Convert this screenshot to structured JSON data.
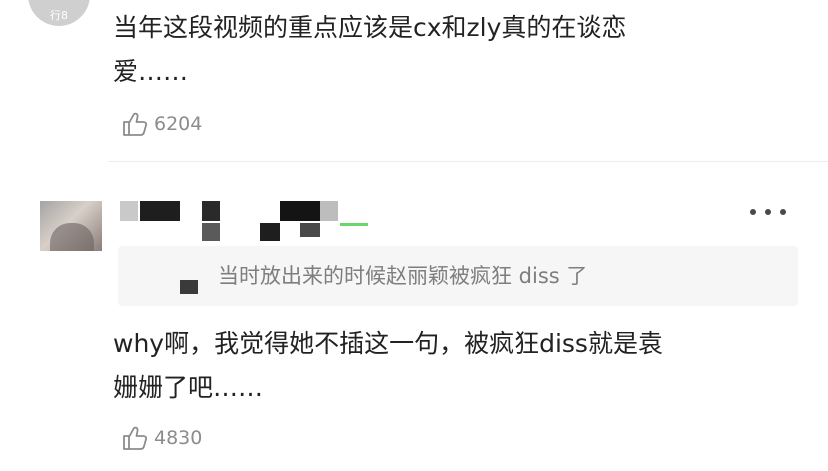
{
  "comments": [
    {
      "avatar_caption": "行8",
      "text_line1": "当年这段视频的重点应该是cx和zly真的在谈恋",
      "text_line2": "爱……",
      "likes": "6204"
    },
    {
      "quote": "当时放出来的时候赵丽颖被疯狂 diss 了",
      "text_line1": "why啊，我觉得她不插这一句，被疯狂diss就是袁",
      "text_line2": "姗姗了吧……",
      "likes": "4830"
    }
  ],
  "icons": {
    "like": "thumbs-up-icon",
    "more": "more-dots-icon"
  },
  "colors": {
    "text": "#222222",
    "muted": "#8c8c8c",
    "quote_bg": "#f6f6f6",
    "divider": "#ececec"
  }
}
